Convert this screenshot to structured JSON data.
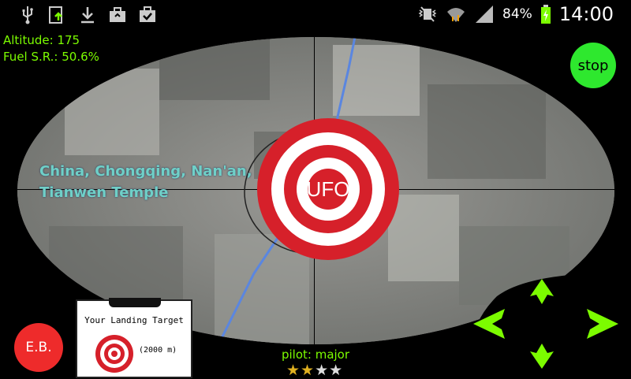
{
  "statusbar": {
    "left_icons": [
      "usb-icon",
      "upload-icon",
      "download-icon",
      "briefcase-icon",
      "clipboard-check-icon"
    ],
    "right_icons": [
      "vibrate-icon",
      "wifi-icon",
      "signal-icon",
      "battery-charging-icon"
    ],
    "battery": "84%",
    "time": "14:00"
  },
  "hud": {
    "altitude": "Altitude: 175",
    "fuel": "Fuel S.R.: 50.6%"
  },
  "location": {
    "line1": "China,  Chongqing,  Nan'an,",
    "line2": "Tianwen Temple"
  },
  "target": {
    "label": "UFO"
  },
  "controls": {
    "stop": "stop",
    "eb": "E.B."
  },
  "landing_card": {
    "title": "Your Landing Target",
    "distance": "(2000 m)"
  },
  "pilot": {
    "label": "pilot: major",
    "rating": 2,
    "max_rating": 4
  },
  "colors": {
    "hud_green": "#7CFC00",
    "stop_green": "#2ee82e",
    "eb_red": "#ee2b2b",
    "target_red": "#d6202a",
    "location_cyan": "#6fd0c8"
  }
}
